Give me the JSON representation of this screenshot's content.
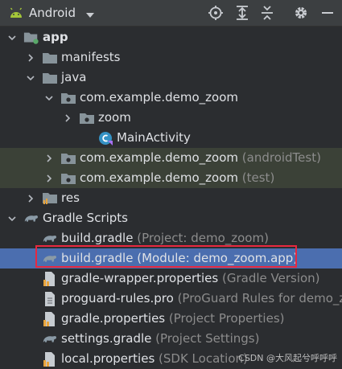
{
  "toolbar": {
    "title": "Android",
    "icons": [
      "android-icon",
      "chevron-down-icon",
      "locate-icon",
      "expand-all-icon",
      "collapse-all-icon",
      "gear-icon",
      "minimize-icon"
    ]
  },
  "tree": [
    {
      "label": "app",
      "sub": "",
      "icon": "module-folder-icon",
      "arrow": "down",
      "indent": 0,
      "bold": true
    },
    {
      "label": "manifests",
      "sub": "",
      "icon": "folder-icon",
      "arrow": "right",
      "indent": 1
    },
    {
      "label": "java",
      "sub": "",
      "icon": "folder-icon",
      "arrow": "down",
      "indent": 1
    },
    {
      "label": "com.example.demo_zoom",
      "sub": "",
      "icon": "package-icon",
      "arrow": "down",
      "indent": 2
    },
    {
      "label": "zoom",
      "sub": "",
      "icon": "package-icon",
      "arrow": "right",
      "indent": 3
    },
    {
      "label": "MainActivity",
      "sub": "",
      "icon": "class-icon",
      "arrow": "none",
      "indent": 4
    },
    {
      "label": "com.example.demo_zoom",
      "sub": "(androidTest)",
      "icon": "package-icon",
      "arrow": "right",
      "indent": 2,
      "state": "green"
    },
    {
      "label": "com.example.demo_zoom",
      "sub": "(test)",
      "icon": "package-icon",
      "arrow": "right",
      "indent": 2,
      "state": "green"
    },
    {
      "label": "res",
      "sub": "",
      "icon": "res-folder-icon",
      "arrow": "right",
      "indent": 1
    },
    {
      "label": "Gradle Scripts",
      "sub": "",
      "icon": "gradle-icon",
      "arrow": "down",
      "indent": 0
    },
    {
      "label": "build.gradle",
      "sub": "(Project: demo_zoom)",
      "icon": "gradle-icon",
      "arrow": "none",
      "indent": 1
    },
    {
      "label": "build.gradle",
      "sub": "(Module: demo_zoom.app)",
      "icon": "gradle-icon",
      "arrow": "none",
      "indent": 1,
      "state": "selected"
    },
    {
      "label": "gradle-wrapper.properties",
      "sub": "(Gradle Version)",
      "icon": "properties-icon",
      "arrow": "none",
      "indent": 1
    },
    {
      "label": "proguard-rules.pro",
      "sub": "(ProGuard Rules for demo_z",
      "icon": "file-icon",
      "arrow": "none",
      "indent": 1
    },
    {
      "label": "gradle.properties",
      "sub": "(Project Properties)",
      "icon": "properties-icon",
      "arrow": "none",
      "indent": 1
    },
    {
      "label": "settings.gradle",
      "sub": "(Project Settings)",
      "icon": "gradle-icon",
      "arrow": "none",
      "indent": 1
    },
    {
      "label": "local.properties",
      "sub": "(SDK Location)",
      "icon": "properties-icon",
      "arrow": "none",
      "indent": 1
    }
  ],
  "watermark": "CSDN @大风起兮呼呼呼",
  "colors": {
    "background": "#2b2d30",
    "selected": "#4b6eaf",
    "test_source": "#3b4137",
    "highlight": "#e8283f",
    "folder": "#87939a",
    "android": "#a4c639"
  }
}
